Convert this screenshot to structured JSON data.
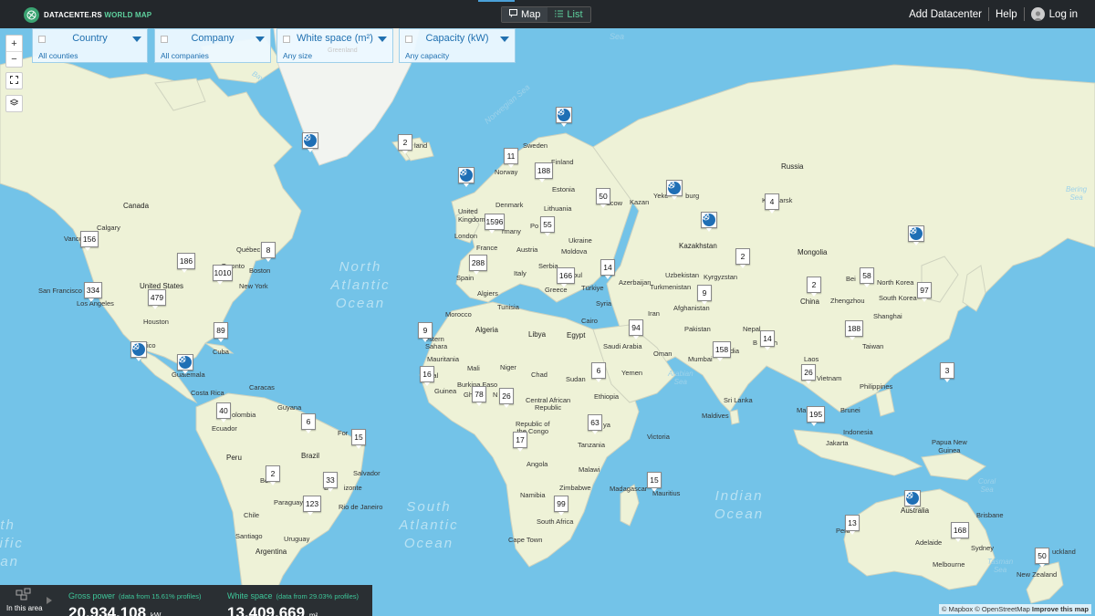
{
  "brand": {
    "name": "DATACENTE.RS",
    "accent": "WORLD MAP"
  },
  "view_switch": {
    "map": "Map",
    "list": "List"
  },
  "top_nav": {
    "add": "Add Datacenter",
    "help": "Help",
    "login": "Log in"
  },
  "filters": [
    {
      "title": "Country",
      "sub": "All counties",
      "hint": ""
    },
    {
      "title": "Company",
      "sub": "All companies",
      "hint": ""
    },
    {
      "title": "White space (m²)",
      "sub": "Any size",
      "hint": "Greenland"
    },
    {
      "title": "Capacity (kW)",
      "sub": "Any capacity",
      "hint": ""
    }
  ],
  "oceans": {
    "north_atlantic": "North\nAtlantic\nOcean",
    "south_atlantic": "South\nAtlantic\nOcean",
    "indian": "Indian\nOcean",
    "pacific_left": "uth\ncific\nean"
  },
  "seas": {
    "norwegian": "Norwegian Sea",
    "sea_top": "Sea",
    "bering": "Bering\nSea",
    "arabian": "Arabian\nSea",
    "coral": "Coral\nSea",
    "tasman": "Tasman\nSea",
    "bay": "Bay"
  },
  "places": {
    "canada": "Canada",
    "united_states": "United States",
    "greenland": "land",
    "calgary": "Calgary",
    "vancouver": "Vanco",
    "san_francisco": "San Francisco",
    "los_angeles": "Los Angeles",
    "houston": "Houston",
    "toronto": "Toronto",
    "quebec": "Québec",
    "boston": "Boston",
    "new_york": "New York",
    "mexico": "ico",
    "cuba": "Cuba",
    "guatemala": "Guatemala",
    "costa_rica": "Costa Rica",
    "caracas": "Caracas",
    "guyana": "Guyana",
    "colombia": "olombia",
    "ecuador": "Ecuador",
    "peru": "Peru",
    "brazil": "Brazil",
    "fortaleza": "For",
    "salvador": "Salvador",
    "bolivia": "Bo",
    "belo_horizonte": "Be      izonte",
    "rio": "Rio de Janeiro",
    "paraguay": "Paraguay",
    "chile": "Chile",
    "santiago": "Santiago",
    "uruguay": "Uruguay",
    "argentina": "Argentina",
    "sweden": "Sweden",
    "finland": "Finland",
    "norway": "Norway",
    "estonia": "Estonia",
    "denmark": "Denmark",
    "uk": "United\nKingdom",
    "lithuania": "Lithuania",
    "london": "London",
    "germany": "rmany",
    "poland": "Po",
    "france": "France",
    "austria": "Austria",
    "ukraine": "Ukraine",
    "moldova": "Moldova",
    "serbia": "Serbia",
    "spain": "Spain",
    "italy": "Italy",
    "greece": "Greece",
    "turkiye": "Türkiye",
    "istanbul": "bul",
    "moscow": "scow",
    "kazan": "Kazan",
    "yekaterinburg": "Yeke         burg",
    "krasnoyarsk": "K   oyarsk",
    "russia": "Russia",
    "kazakhstan": "Kazakhstan",
    "mongolia": "Mongolia",
    "uzbekistan": "Uzbekistan",
    "kyrgyzstan": "Kyrgyzstan",
    "azerbaijan": "Azerbaijan",
    "turkmenistan": "Turkmenistan",
    "syria": "Syria",
    "iran": "Iran",
    "afghanistan": "Afghanistan",
    "pakistan": "Pakistan",
    "nepal": "Nepal",
    "bangladesh": "B    lesh",
    "india": "dia",
    "china": "China",
    "beijing": "Bei",
    "north_korea": "North Korea",
    "south_korea": "South Korea",
    "zhengzhou": "Zhengzhou",
    "shanghai": "Shanghai",
    "taiwan": "Taiwan",
    "laos": "Laos",
    "vietnam": "Vietnam",
    "philippines": "Philippines",
    "mumbai": "Mumbai",
    "sri_lanka": "Sri Lanka",
    "maldives": "Maldives",
    "malaysia": "Ma",
    "brunei": "Brunei",
    "indonesia": "Indonesia",
    "jakarta": "Jakarta",
    "papua": "Papua New\nGuinea",
    "morocco": "Morocco",
    "algiers": "Algiers",
    "tunisia": "Tunisia",
    "algeria": "Algeria",
    "libya": "Libya",
    "egypt": "Egypt",
    "cairo": "Cairo",
    "saudi": "Saudi Arabia",
    "oman": "Oman",
    "yemen": "Yemen",
    "sudan": "Sudan",
    "chad": "Chad",
    "niger": "Niger",
    "mali": "Mali",
    "mauritania": "Mauritania",
    "western_sahara": "estern\nSahara",
    "senegal": "S    al",
    "guinea": "Guinea",
    "burkina": "Burkina Faso",
    "ghana": "Gh",
    "nigeria": "N",
    "car": "Central African\nRepublic",
    "ethiopia": "Ethiopia",
    "congo": "Republic of\nthe Congo",
    "kenya": "ya",
    "tanzania": "Tanzania",
    "victoria": "Victoria",
    "angola": "Angola",
    "malawi": "Malawi",
    "zimbabwe": "Zimbabwe",
    "namibia": "Namibia",
    "madagascar": "Madagascar",
    "mauritius": "Mauritius",
    "south_africa": "South Africa",
    "cape_town": "Cape Town",
    "australia": "Australia",
    "brisbane": "Brisbane",
    "perth": "Perth",
    "adelaide": "Adelaide",
    "sydney": "Sydney",
    "melbourne": "Melbourne",
    "auckland": "uckland",
    "new_zealand": "New Zealand"
  },
  "markers": [
    {
      "id": "greenland",
      "label": "2"
    },
    {
      "id": "vancouver",
      "label": "156"
    },
    {
      "id": "quebec",
      "label": "8"
    },
    {
      "id": "usa_mid",
      "label": "186"
    },
    {
      "id": "toronto",
      "label": "1010"
    },
    {
      "id": "sf",
      "label": "334"
    },
    {
      "id": "la",
      "label": "479"
    },
    {
      "id": "florida",
      "label": "89"
    },
    {
      "id": "colombia",
      "label": "40"
    },
    {
      "id": "guyana",
      "label": "6"
    },
    {
      "id": "fortaleza",
      "label": "15"
    },
    {
      "id": "bolivia",
      "label": "2"
    },
    {
      "id": "belo",
      "label": "33"
    },
    {
      "id": "paraguay",
      "label": "123"
    },
    {
      "id": "sweden",
      "label": "11"
    },
    {
      "id": "finland",
      "label": "188"
    },
    {
      "id": "uk",
      "label": "1596"
    },
    {
      "id": "poland",
      "label": "55"
    },
    {
      "id": "moscow",
      "label": "50"
    },
    {
      "id": "krasnoyarsk",
      "label": "4"
    },
    {
      "id": "kazakh",
      "label": "2"
    },
    {
      "id": "mongolia",
      "label": "2"
    },
    {
      "id": "beijing",
      "label": "58"
    },
    {
      "id": "korea",
      "label": "97"
    },
    {
      "id": "spain",
      "label": "288"
    },
    {
      "id": "greece",
      "label": "166"
    },
    {
      "id": "caucasus",
      "label": "14"
    },
    {
      "id": "kyrgyz",
      "label": "9"
    },
    {
      "id": "saudi",
      "label": "94"
    },
    {
      "id": "morocco",
      "label": "9"
    },
    {
      "id": "shanghai",
      "label": "188"
    },
    {
      "id": "india",
      "label": "158"
    },
    {
      "id": "bangladesh",
      "label": "14"
    },
    {
      "id": "vietnam",
      "label": "26"
    },
    {
      "id": "philippines",
      "label": "3"
    },
    {
      "id": "senegal",
      "label": "16"
    },
    {
      "id": "ghana",
      "label": "78"
    },
    {
      "id": "nigeria",
      "label": "26"
    },
    {
      "id": "yemen",
      "label": "6"
    },
    {
      "id": "malaysia",
      "label": "195"
    },
    {
      "id": "kenya",
      "label": "63"
    },
    {
      "id": "congo",
      "label": "17"
    },
    {
      "id": "mauritius",
      "label": "15"
    },
    {
      "id": "southafrica",
      "label": "99"
    },
    {
      "id": "perth",
      "label": "13"
    },
    {
      "id": "sydney",
      "label": "168"
    },
    {
      "id": "auckland",
      "label": "50"
    }
  ],
  "stats": {
    "in_area": "In this area",
    "gross_power_label": "Gross power",
    "gross_power_note": "(data from 15.61% profiles)",
    "gross_power_value": "20.934.108",
    "gross_power_unit": "kW",
    "white_space_label": "White space",
    "white_space_note": "(data from 29.03% profiles)",
    "white_space_value": "13.409.669",
    "white_space_unit": "m²"
  },
  "attribution": {
    "mapbox": "© Mapbox",
    "osm": "© OpenStreetMap",
    "improve": "Improve this map"
  },
  "colors": {
    "topbar": "#23272b",
    "ocean": "#73c3e8",
    "land": "#eef2d7",
    "accent": "#3ec79a",
    "pin": "#1f6fb5",
    "filter_text": "#2070b0"
  }
}
